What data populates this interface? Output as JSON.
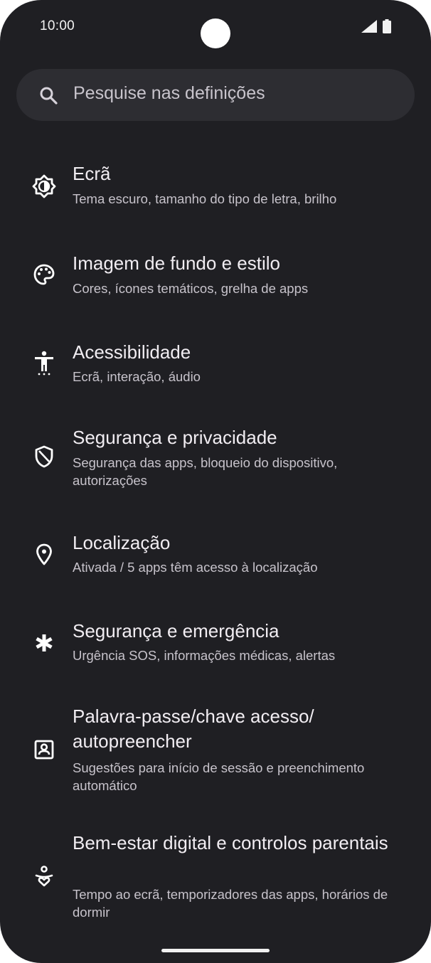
{
  "status_bar": {
    "time": "10:00",
    "icons": [
      "signal-icon",
      "battery-icon"
    ]
  },
  "search": {
    "placeholder": "Pesquise nas definições",
    "icon": "search-icon"
  },
  "settings_items": [
    {
      "icon": "display-icon",
      "title": "Ecrã",
      "subtitle": "Tema escuro, tamanho do tipo de letra, brilho"
    },
    {
      "icon": "palette-icon",
      "title": "Imagem de fundo e estilo",
      "subtitle": "Cores, ícones temáticos, grelha de apps"
    },
    {
      "icon": "accessibility-icon",
      "title": "Acessibilidade",
      "subtitle": "Ecrã, interação, áudio"
    },
    {
      "icon": "shield-icon",
      "title": "Segurança e privacidade",
      "subtitle": "Segurança das apps, bloqueio do dispositivo, autorizações"
    },
    {
      "icon": "location-pin-icon",
      "title": "Localização",
      "subtitle": "Ativada / 5 apps têm acesso à localização"
    },
    {
      "icon": "asterisk-icon",
      "title": "Segurança e emergência",
      "subtitle": "Urgência SOS, informações médicas, alertas"
    },
    {
      "icon": "account-box-icon",
      "title": "Palavra-passe/chave acesso/ autopreencher",
      "subtitle": "Sugestões para início de sessão e preenchimento automático"
    },
    {
      "icon": "wellbeing-icon",
      "title": "Bem-estar digital e controlos parentais",
      "subtitle": "Tempo ao ecrã, temporizadores das apps, horários de dormir"
    }
  ]
}
